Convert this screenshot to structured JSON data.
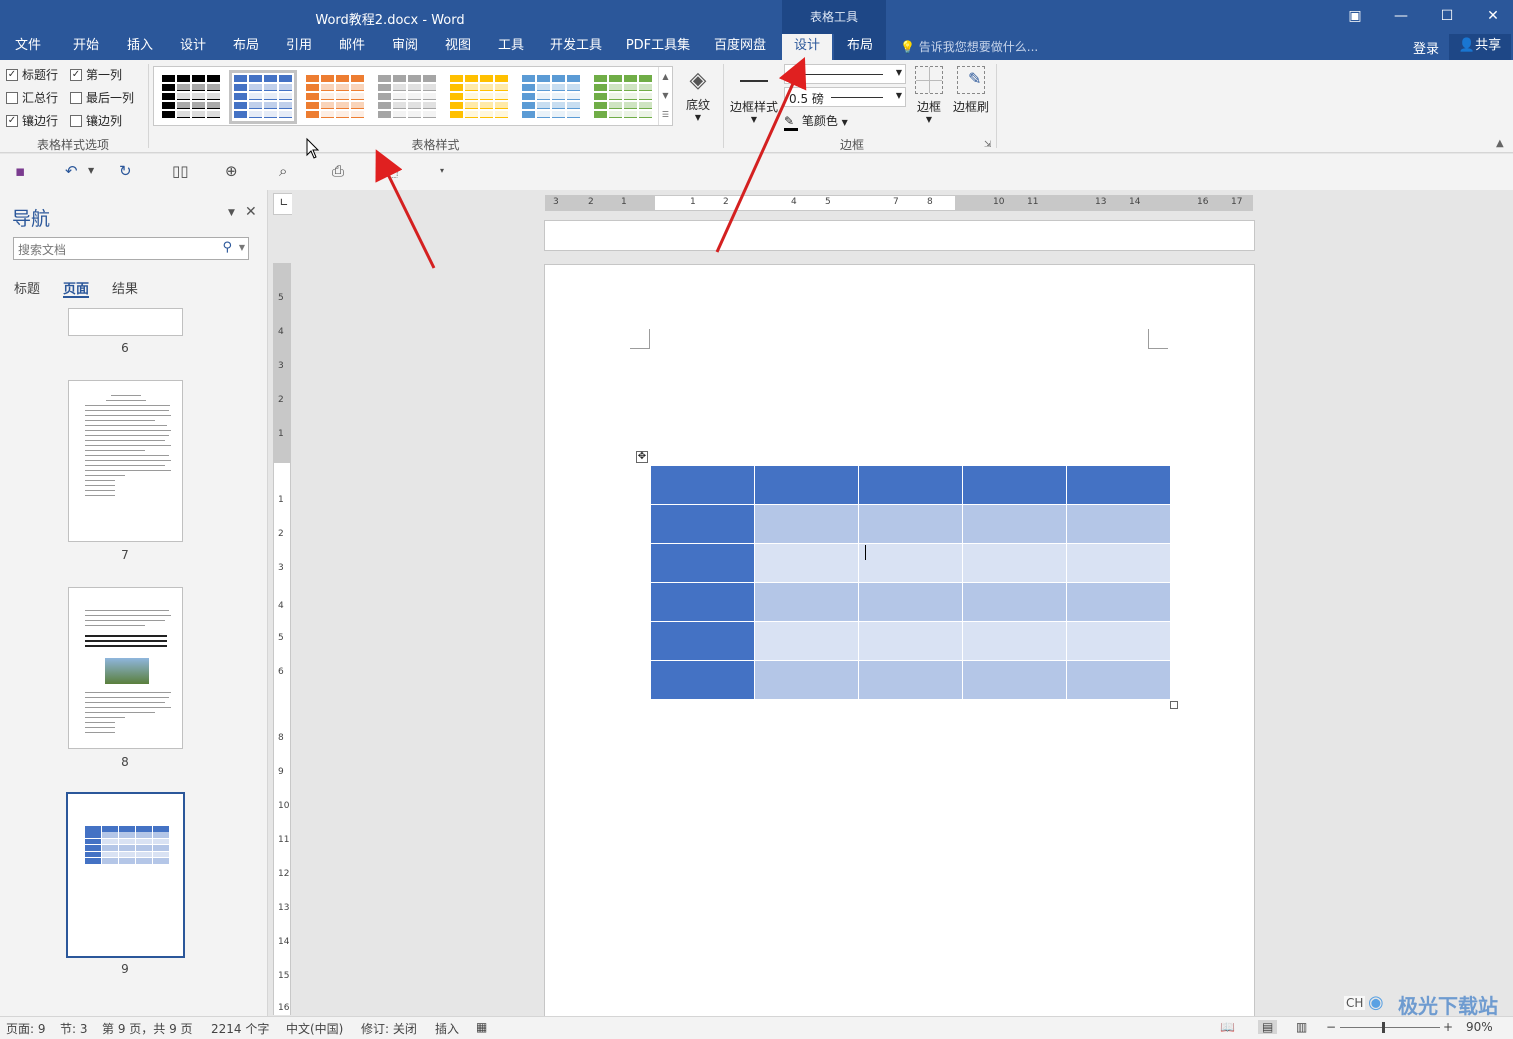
{
  "window": {
    "title": "Word教程2.docx - Word",
    "context_tab_group": "表格工具"
  },
  "ribbon_tabs": [
    "文件",
    "开始",
    "插入",
    "设计",
    "布局",
    "引用",
    "邮件",
    "审阅",
    "视图",
    "工具",
    "开发工具",
    "PDF工具集",
    "百度网盘",
    "设计",
    "布局"
  ],
  "active_tab": "设计",
  "tell_me": "告诉我您想要做什么...",
  "account": {
    "login": "登录",
    "share": "共享"
  },
  "table_style_options": {
    "group_label": "表格样式选项",
    "options": [
      {
        "label": "标题行",
        "checked": true
      },
      {
        "label": "第一列",
        "checked": true
      },
      {
        "label": "汇总行",
        "checked": false
      },
      {
        "label": "最后一列",
        "checked": false
      },
      {
        "label": "镶边行",
        "checked": true
      },
      {
        "label": "镶边列",
        "checked": false
      }
    ]
  },
  "table_styles": {
    "group_label": "表格样式",
    "shading_label": "底纹",
    "styles": [
      {
        "color": "#000000"
      },
      {
        "color": "#4472c4"
      },
      {
        "color": "#ed7d31"
      },
      {
        "color": "#a5a5a5"
      },
      {
        "color": "#ffc000"
      },
      {
        "color": "#5b9bd5"
      },
      {
        "color": "#70ad47"
      }
    ],
    "selected_index": 1
  },
  "borders": {
    "group_label": "边框",
    "border_styles_label": "边框样式",
    "weight": "0.5 磅",
    "pen_color_label": "笔颜色",
    "borders_label": "边框",
    "border_painter_label": "边框刷"
  },
  "navigation": {
    "title": "导航",
    "search_placeholder": "搜索文档",
    "tabs": [
      "标题",
      "页面",
      "结果"
    ],
    "active_tab": "页面",
    "pages": [
      "6",
      "7",
      "8",
      "9"
    ]
  },
  "document": {
    "table": {
      "rows": 6,
      "cols": 5,
      "header_color": "#4472c4",
      "band_dark": "#b4c6e7",
      "band_light": "#d9e2f3"
    }
  },
  "hruler_labels": [
    "3",
    "2",
    "1",
    "1",
    "2",
    "4",
    "5",
    "7",
    "8",
    "10",
    "11",
    "13",
    "14",
    "16",
    "17"
  ],
  "vruler_labels": [
    "5",
    "4",
    "3",
    "2",
    "1",
    "1",
    "2",
    "3",
    "4",
    "5",
    "6",
    "8",
    "9",
    "10",
    "11",
    "12",
    "13",
    "14",
    "15",
    "16"
  ],
  "statusbar": {
    "page": "页面: 9",
    "section": "节: 3",
    "page_of": "第 9 页，共 9 页",
    "words": "2214 个字",
    "language": "中文(中国)",
    "track_changes": "修订: 关闭",
    "insert_mode": "插入",
    "zoom": "90%"
  },
  "watermark": {
    "text": "极光下载站",
    "ime": "CH"
  }
}
